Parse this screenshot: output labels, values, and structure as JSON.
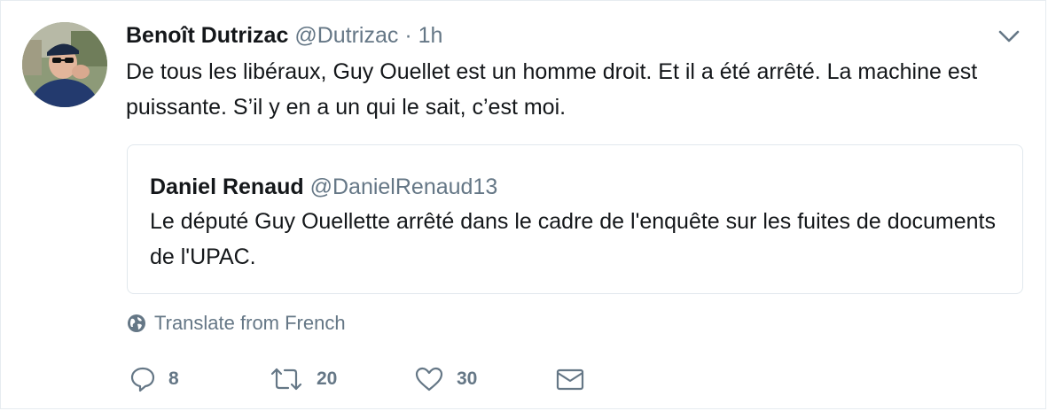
{
  "tweet": {
    "author_name": "Benoît Dutrizac",
    "author_handle": "@Dutrizac",
    "separator": "·",
    "time": "1h",
    "text": "De tous les libéraux, Guy Ouellet est un homme droit. Et il a été arrêté. La machine est puissante. S’il y en a un qui le sait, c’est moi."
  },
  "quoted_tweet": {
    "author_name": "Daniel Renaud",
    "author_handle": "@DanielRenaud13",
    "text": "Le député Guy Ouellette arrêté dans le cadre de l'enquête sur les fuites de documents de l'UPAC."
  },
  "translate": {
    "label": "Translate from French",
    "icon": "globe-icon"
  },
  "actions": {
    "reply": {
      "icon": "reply-icon",
      "count": "8"
    },
    "retweet": {
      "icon": "retweet-icon",
      "count": "20"
    },
    "like": {
      "icon": "heart-icon",
      "count": "30"
    },
    "dm": {
      "icon": "envelope-icon"
    }
  },
  "menu": {
    "icon": "chevron-down-icon"
  },
  "colors": {
    "text": "#14171a",
    "secondary": "#657786",
    "border": "#e1e8ed",
    "background": "#ffffff"
  }
}
